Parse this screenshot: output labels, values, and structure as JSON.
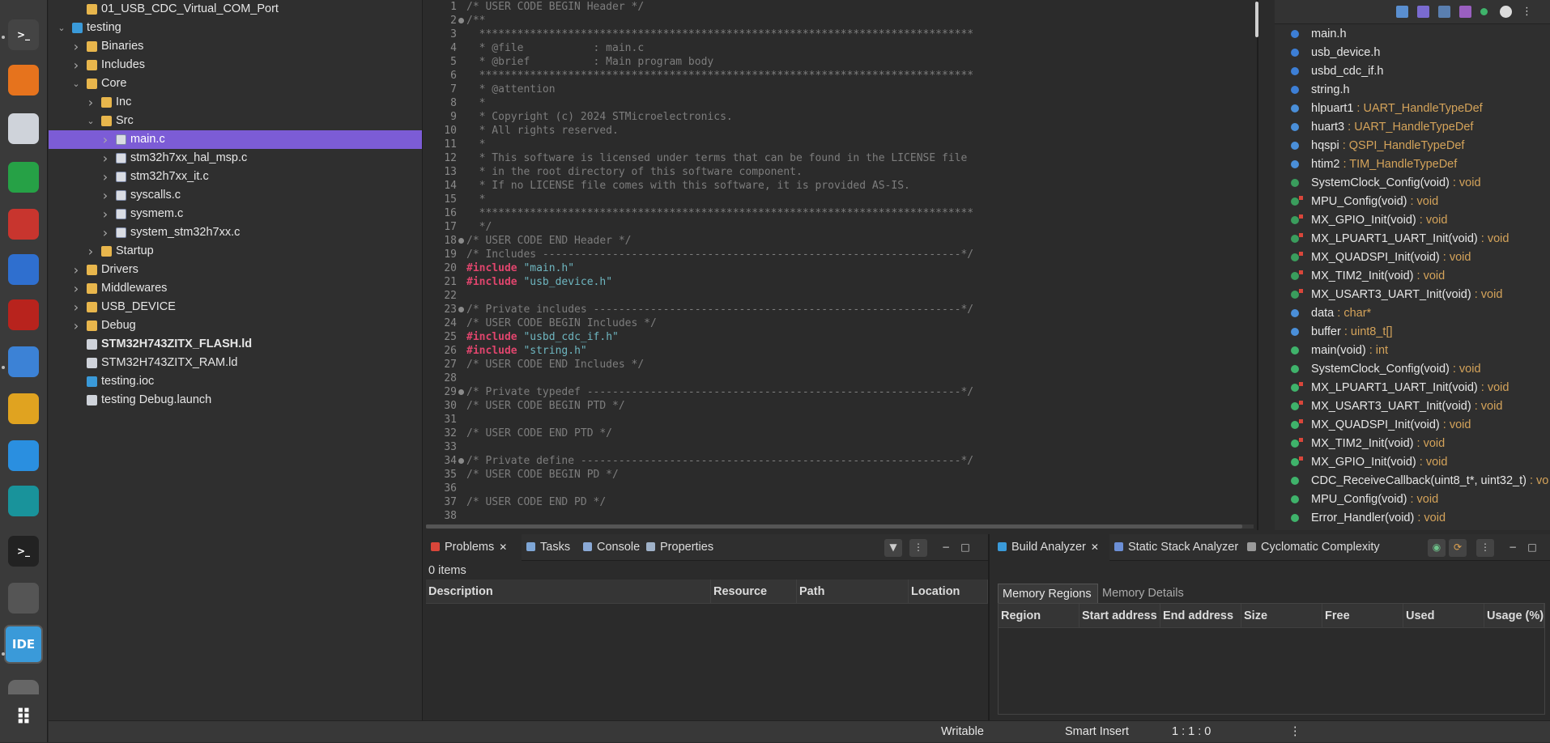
{
  "dock": {
    "items": [
      {
        "icon": "terminal-small-icon",
        "color": "#444444"
      },
      {
        "icon": "vlc-icon",
        "color": "#e6731d"
      },
      {
        "icon": "document-viewer-icon",
        "color": "#cfd3da"
      },
      {
        "icon": "spreadsheet-icon",
        "color": "#26a146"
      },
      {
        "icon": "pdf-tool-icon",
        "color": "#c8352e"
      },
      {
        "icon": "vnc-viewer-icon",
        "color": "#2f6fcf"
      },
      {
        "icon": "filezilla-icon",
        "color": "#b8231d"
      },
      {
        "icon": "text-editor-icon",
        "color": "#3c82d6"
      },
      {
        "icon": "calculator-icon",
        "color": "#e0a320"
      },
      {
        "icon": "vscode-icon",
        "color": "#2a8fe0"
      },
      {
        "icon": "arduino-icon",
        "color": "#19939b"
      },
      {
        "icon": "terminal-icon",
        "color": "#222222"
      },
      {
        "icon": "software-center-icon",
        "color": "#555555"
      },
      {
        "icon": "stm32cubeide-icon",
        "color": "#3a9ad9"
      },
      {
        "icon": "disk-icon",
        "color": "#666666"
      },
      {
        "icon": "app-grid-icon",
        "color": "#3a3a3a"
      }
    ],
    "ide_label": "IDE",
    "prompt_glyph": ">_"
  },
  "explorer": {
    "rows": [
      {
        "label": "01_USB_CDC_Virtual_COM_Port",
        "indent": 1,
        "chev": "",
        "icon": "folder",
        "bold": false,
        "sel": false
      },
      {
        "label": "testing",
        "indent": 0,
        "chev": "down",
        "icon": "proj",
        "bold": false,
        "sel": false
      },
      {
        "label": "Binaries",
        "indent": 1,
        "chev": "right",
        "icon": "folder",
        "bold": false,
        "sel": false
      },
      {
        "label": "Includes",
        "indent": 1,
        "chev": "right",
        "icon": "folder",
        "bold": false,
        "sel": false
      },
      {
        "label": "Core",
        "indent": 1,
        "chev": "down",
        "icon": "folder",
        "bold": false,
        "sel": false
      },
      {
        "label": "Inc",
        "indent": 2,
        "chev": "right",
        "icon": "folder",
        "bold": false,
        "sel": false
      },
      {
        "label": "Src",
        "indent": 2,
        "chev": "down",
        "icon": "folder",
        "bold": false,
        "sel": false
      },
      {
        "label": "main.c",
        "indent": 3,
        "chev": "right",
        "icon": "file-c",
        "bold": false,
        "sel": true
      },
      {
        "label": "stm32h7xx_hal_msp.c",
        "indent": 3,
        "chev": "right",
        "icon": "file-c",
        "bold": false,
        "sel": false
      },
      {
        "label": "stm32h7xx_it.c",
        "indent": 3,
        "chev": "right",
        "icon": "file-c",
        "bold": false,
        "sel": false
      },
      {
        "label": "syscalls.c",
        "indent": 3,
        "chev": "right",
        "icon": "file-c",
        "bold": false,
        "sel": false
      },
      {
        "label": "sysmem.c",
        "indent": 3,
        "chev": "right",
        "icon": "file-c",
        "bold": false,
        "sel": false
      },
      {
        "label": "system_stm32h7xx.c",
        "indent": 3,
        "chev": "right",
        "icon": "file-c",
        "bold": false,
        "sel": false
      },
      {
        "label": "Startup",
        "indent": 2,
        "chev": "right",
        "icon": "folder",
        "bold": false,
        "sel": false
      },
      {
        "label": "Drivers",
        "indent": 1,
        "chev": "right",
        "icon": "folder",
        "bold": false,
        "sel": false
      },
      {
        "label": "Middlewares",
        "indent": 1,
        "chev": "right",
        "icon": "folder",
        "bold": false,
        "sel": false
      },
      {
        "label": "USB_DEVICE",
        "indent": 1,
        "chev": "right",
        "icon": "folder",
        "bold": false,
        "sel": false
      },
      {
        "label": "Debug",
        "indent": 1,
        "chev": "right",
        "icon": "folder",
        "bold": false,
        "sel": false
      },
      {
        "label": "STM32H743ZITX_FLASH.ld",
        "indent": 1,
        "chev": "",
        "icon": "ldfile",
        "bold": true,
        "sel": false
      },
      {
        "label": "STM32H743ZITX_RAM.ld",
        "indent": 1,
        "chev": "",
        "icon": "ldfile",
        "bold": false,
        "sel": false
      },
      {
        "label": "testing.ioc",
        "indent": 1,
        "chev": "",
        "icon": "proj",
        "bold": false,
        "sel": false
      },
      {
        "label": "testing Debug.launch",
        "indent": 1,
        "chev": "",
        "icon": "ldfile",
        "bold": false,
        "sel": false
      }
    ]
  },
  "editor": {
    "lines": [
      {
        "n": "1",
        "fold": false,
        "parts": [
          {
            "t": "/* USER CODE BEGIN Header */",
            "c": "cm"
          }
        ]
      },
      {
        "n": "2",
        "fold": true,
        "parts": [
          {
            "t": "/**",
            "c": "cm"
          }
        ]
      },
      {
        "n": "3",
        "fold": false,
        "parts": [
          {
            "t": "  ******************************************************************************",
            "c": "cm"
          }
        ]
      },
      {
        "n": "4",
        "fold": false,
        "parts": [
          {
            "t": "  * @file           : main.c",
            "c": "cm"
          }
        ]
      },
      {
        "n": "5",
        "fold": false,
        "parts": [
          {
            "t": "  * @brief          : Main program body",
            "c": "cm"
          }
        ]
      },
      {
        "n": "6",
        "fold": false,
        "parts": [
          {
            "t": "  ******************************************************************************",
            "c": "cm"
          }
        ]
      },
      {
        "n": "7",
        "fold": false,
        "parts": [
          {
            "t": "  * @attention",
            "c": "cm"
          }
        ]
      },
      {
        "n": "8",
        "fold": false,
        "parts": [
          {
            "t": "  *",
            "c": "cm"
          }
        ]
      },
      {
        "n": "9",
        "fold": false,
        "parts": [
          {
            "t": "  * Copyright (c) 2024 STMicroelectronics.",
            "c": "cm"
          }
        ]
      },
      {
        "n": "10",
        "fold": false,
        "parts": [
          {
            "t": "  * All rights reserved.",
            "c": "cm"
          }
        ]
      },
      {
        "n": "11",
        "fold": false,
        "parts": [
          {
            "t": "  *",
            "c": "cm"
          }
        ]
      },
      {
        "n": "12",
        "fold": false,
        "parts": [
          {
            "t": "  * This software is licensed under terms that can be found in the LICENSE file",
            "c": "cm"
          }
        ]
      },
      {
        "n": "13",
        "fold": false,
        "parts": [
          {
            "t": "  * in the root directory of this software component.",
            "c": "cm"
          }
        ]
      },
      {
        "n": "14",
        "fold": false,
        "parts": [
          {
            "t": "  * If no LICENSE file comes with this software, it is provided AS-IS.",
            "c": "cm"
          }
        ]
      },
      {
        "n": "15",
        "fold": false,
        "parts": [
          {
            "t": "  *",
            "c": "cm"
          }
        ]
      },
      {
        "n": "16",
        "fold": false,
        "parts": [
          {
            "t": "  ******************************************************************************",
            "c": "cm"
          }
        ]
      },
      {
        "n": "17",
        "fold": false,
        "parts": [
          {
            "t": "  */",
            "c": "cm"
          }
        ]
      },
      {
        "n": "18",
        "fold": true,
        "parts": [
          {
            "t": "/* USER CODE END Header */",
            "c": "cm"
          }
        ]
      },
      {
        "n": "19",
        "fold": false,
        "parts": [
          {
            "t": "/* Includes ------------------------------------------------------------------*/",
            "c": "cm"
          }
        ]
      },
      {
        "n": "20",
        "fold": false,
        "parts": [
          {
            "t": "#include ",
            "c": "kw"
          },
          {
            "t": "\"main.h\"",
            "c": "str"
          }
        ]
      },
      {
        "n": "21",
        "fold": false,
        "parts": [
          {
            "t": "#include ",
            "c": "kw"
          },
          {
            "t": "\"usb_device.h\"",
            "c": "str"
          }
        ]
      },
      {
        "n": "22",
        "fold": false,
        "parts": [
          {
            "t": "",
            "c": "cm"
          }
        ]
      },
      {
        "n": "23",
        "fold": true,
        "parts": [
          {
            "t": "/* Private includes ----------------------------------------------------------*/",
            "c": "cm"
          }
        ]
      },
      {
        "n": "24",
        "fold": false,
        "parts": [
          {
            "t": "/* USER CODE BEGIN Includes */",
            "c": "cm"
          }
        ]
      },
      {
        "n": "25",
        "fold": false,
        "parts": [
          {
            "t": "#include ",
            "c": "kw"
          },
          {
            "t": "\"usbd_cdc_if.h\"",
            "c": "str"
          }
        ]
      },
      {
        "n": "26",
        "fold": false,
        "parts": [
          {
            "t": "#include ",
            "c": "kw"
          },
          {
            "t": "\"string.h\"",
            "c": "str"
          }
        ]
      },
      {
        "n": "27",
        "fold": false,
        "parts": [
          {
            "t": "/* USER CODE END Includes */",
            "c": "cm"
          }
        ]
      },
      {
        "n": "28",
        "fold": false,
        "parts": [
          {
            "t": "",
            "c": "cm"
          }
        ]
      },
      {
        "n": "29",
        "fold": true,
        "parts": [
          {
            "t": "/* Private typedef -----------------------------------------------------------*/",
            "c": "cm"
          }
        ]
      },
      {
        "n": "30",
        "fold": false,
        "parts": [
          {
            "t": "/* USER CODE BEGIN PTD */",
            "c": "cm"
          }
        ]
      },
      {
        "n": "31",
        "fold": false,
        "parts": [
          {
            "t": "",
            "c": "cm"
          }
        ]
      },
      {
        "n": "32",
        "fold": false,
        "parts": [
          {
            "t": "/* USER CODE END PTD */",
            "c": "cm"
          }
        ]
      },
      {
        "n": "33",
        "fold": false,
        "parts": [
          {
            "t": "",
            "c": "cm"
          }
        ]
      },
      {
        "n": "34",
        "fold": true,
        "parts": [
          {
            "t": "/* Private define ------------------------------------------------------------*/",
            "c": "cm"
          }
        ]
      },
      {
        "n": "35",
        "fold": false,
        "parts": [
          {
            "t": "/* USER CODE BEGIN PD */",
            "c": "cm"
          }
        ]
      },
      {
        "n": "36",
        "fold": false,
        "parts": [
          {
            "t": "",
            "c": "cm"
          }
        ]
      },
      {
        "n": "37",
        "fold": false,
        "parts": [
          {
            "t": "/* USER CODE END PD */",
            "c": "cm"
          }
        ]
      },
      {
        "n": "38",
        "fold": false,
        "parts": [
          {
            "t": "",
            "c": "cm"
          }
        ]
      }
    ]
  },
  "outline": {
    "items": [
      {
        "name": "main.h",
        "type": "",
        "icon": "#3d7fd6",
        "badge": false
      },
      {
        "name": "usb_device.h",
        "type": "",
        "icon": "#3d7fd6",
        "badge": false
      },
      {
        "name": "usbd_cdc_if.h",
        "type": "",
        "icon": "#3d7fd6",
        "badge": false
      },
      {
        "name": "string.h",
        "type": "",
        "icon": "#3d7fd6",
        "badge": false
      },
      {
        "name": "hlpuart1",
        "type": " : UART_HandleTypeDef",
        "icon": "#4a8fd9",
        "badge": false
      },
      {
        "name": "huart3",
        "type": " : UART_HandleTypeDef",
        "icon": "#4a8fd9",
        "badge": false
      },
      {
        "name": "hqspi",
        "type": " : QSPI_HandleTypeDef",
        "icon": "#4a8fd9",
        "badge": false
      },
      {
        "name": "htim2",
        "type": " : TIM_HandleTypeDef",
        "icon": "#4a8fd9",
        "badge": false
      },
      {
        "name": "SystemClock_Config(void)",
        "type": " : void",
        "icon": "#3a9d5d",
        "badge": false
      },
      {
        "name": "MPU_Config(void)",
        "type": " : void",
        "icon": "#3a9d5d",
        "badge": true
      },
      {
        "name": "MX_GPIO_Init(void)",
        "type": " : void",
        "icon": "#3a9d5d",
        "badge": true
      },
      {
        "name": "MX_LPUART1_UART_Init(void)",
        "type": " : void",
        "icon": "#3a9d5d",
        "badge": true
      },
      {
        "name": "MX_QUADSPI_Init(void)",
        "type": " : void",
        "icon": "#3a9d5d",
        "badge": true
      },
      {
        "name": "MX_TIM2_Init(void)",
        "type": " : void",
        "icon": "#3a9d5d",
        "badge": true
      },
      {
        "name": "MX_USART3_UART_Init(void)",
        "type": " : void",
        "icon": "#3a9d5d",
        "badge": true
      },
      {
        "name": "data",
        "type": " : char*",
        "icon": "#4a8fd9",
        "badge": false
      },
      {
        "name": "buffer",
        "type": " : uint8_t[]",
        "icon": "#4a8fd9",
        "badge": false
      },
      {
        "name": "main(void)",
        "type": " : int",
        "icon": "#3fb36b",
        "badge": false
      },
      {
        "name": "SystemClock_Config(void)",
        "type": " : void",
        "icon": "#3fb36b",
        "badge": false
      },
      {
        "name": "MX_LPUART1_UART_Init(void)",
        "type": " : void",
        "icon": "#3fb36b",
        "badge": true
      },
      {
        "name": "MX_USART3_UART_Init(void)",
        "type": " : void",
        "icon": "#3fb36b",
        "badge": true
      },
      {
        "name": "MX_QUADSPI_Init(void)",
        "type": " : void",
        "icon": "#3fb36b",
        "badge": true
      },
      {
        "name": "MX_TIM2_Init(void)",
        "type": " : void",
        "icon": "#3fb36b",
        "badge": true
      },
      {
        "name": "MX_GPIO_Init(void)",
        "type": " : void",
        "icon": "#3fb36b",
        "badge": true
      },
      {
        "name": "CDC_ReceiveCallback(uint8_t*, uint32_t)",
        "type": " : vo",
        "icon": "#3fb36b",
        "badge": false
      },
      {
        "name": "MPU_Config(void)",
        "type": " : void",
        "icon": "#3fb36b",
        "badge": false
      },
      {
        "name": "Error_Handler(void)",
        "type": " : void",
        "icon": "#3fb36b",
        "badge": false
      }
    ]
  },
  "problems": {
    "tabs": [
      {
        "label": "Problems",
        "icon": "#d9463a",
        "active": true,
        "close": true
      },
      {
        "label": "Tasks",
        "icon": "#7ea6d6",
        "active": false,
        "close": false
      },
      {
        "label": "Console",
        "icon": "#8aa9d6",
        "active": false,
        "close": false
      },
      {
        "label": "Properties",
        "icon": "#9fb1c8",
        "active": false,
        "close": false
      }
    ],
    "count": "0 items",
    "columns": [
      "Description",
      "Resource",
      "Path",
      "Location"
    ]
  },
  "build": {
    "tabs": [
      {
        "label": "Build Analyzer",
        "icon": "#3a9ad9",
        "active": true,
        "close": true
      },
      {
        "label": "Static Stack Analyzer",
        "icon": "#6c8fd6",
        "active": false,
        "close": false
      },
      {
        "label": "Cyclomatic Complexity",
        "icon": "#9a9a9a",
        "active": false,
        "close": false
      }
    ],
    "subtabs": [
      "Memory Regions",
      "Memory Details"
    ],
    "columns": [
      "Region",
      "Start address",
      "End address",
      "Size",
      "Free",
      "Used",
      "Usage (%)"
    ]
  },
  "statusbar": {
    "mode": "Writable",
    "insert": "Smart Insert",
    "position": "1 : 1 : 0"
  }
}
